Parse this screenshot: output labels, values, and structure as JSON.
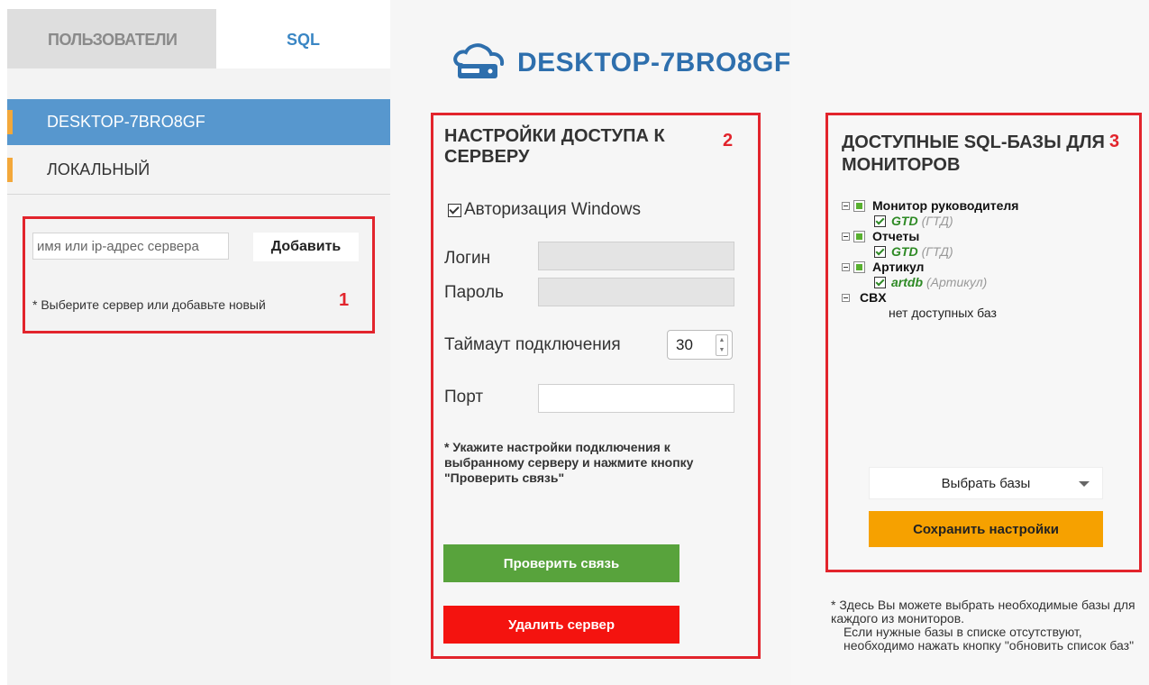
{
  "tabs": {
    "users": "ПОЛЬЗОВАТЕЛИ",
    "sql": "SQL"
  },
  "servers": [
    {
      "label": "DESKTOP-7BRO8GF",
      "active": true
    },
    {
      "label": "ЛОКАЛЬНЫЙ",
      "active": false
    }
  ],
  "add_server": {
    "placeholder": "имя или ip-адрес сервера",
    "button_label": "Добавить",
    "hint": "* Выберите сервер или добавьте новый",
    "marker": "1"
  },
  "server_header": {
    "title": "DESKTOP-7BRO8GF",
    "icon": "cloud-server-icon"
  },
  "access": {
    "title": "НАСТРОЙКИ ДОСТУПА К СЕРВЕРУ",
    "marker": "2",
    "windows_auth_label": "Авторизация Windows",
    "windows_auth_checked": true,
    "login_label": "Логин",
    "password_label": "Пароль",
    "timeout_label": "Таймаут подключения",
    "timeout_value": "30",
    "port_label": "Порт",
    "port_value": "",
    "hint": "* Укажите настройки подключения к выбранному серверу и нажмите кнопку \"Проверить связь\"",
    "check_button": "Проверить связь",
    "delete_button": "Удалить сервер"
  },
  "databases": {
    "title": "ДОСТУПНЫЕ SQL-БАЗЫ ДЛЯ МОНИТОРОВ",
    "marker": "3",
    "tree": [
      {
        "label": "Монитор руководителя",
        "has_marker": true,
        "dbs": [
          {
            "name": "GTD",
            "alias": "(ГТД)"
          }
        ]
      },
      {
        "label": "Отчеты",
        "has_marker": true,
        "dbs": [
          {
            "name": "GTD",
            "alias": "(ГТД)"
          }
        ]
      },
      {
        "label": "Артикул",
        "has_marker": true,
        "dbs": [
          {
            "name": "artdb",
            "alias": "(Артикул)"
          }
        ]
      },
      {
        "label": "CBX",
        "has_marker": false,
        "empty_text": "нет доступных баз"
      }
    ],
    "select_button": "Выбрать базы",
    "save_button": "Сохранить настройки",
    "hint_line1": "* Здесь Вы можете выбрать необходимые базы для каждого из мониторов.",
    "hint_line2": "Если нужные базы в списке отсутствуют, необходимо нажать кнопку \"обновить список баз\""
  },
  "colors": {
    "accent_blue": "#5797ce",
    "title_blue": "#2e6fad",
    "check_green": "#58a33c",
    "delete_red": "#f4130f",
    "save_orange": "#f6a100",
    "annotation_red": "#e2242c"
  }
}
